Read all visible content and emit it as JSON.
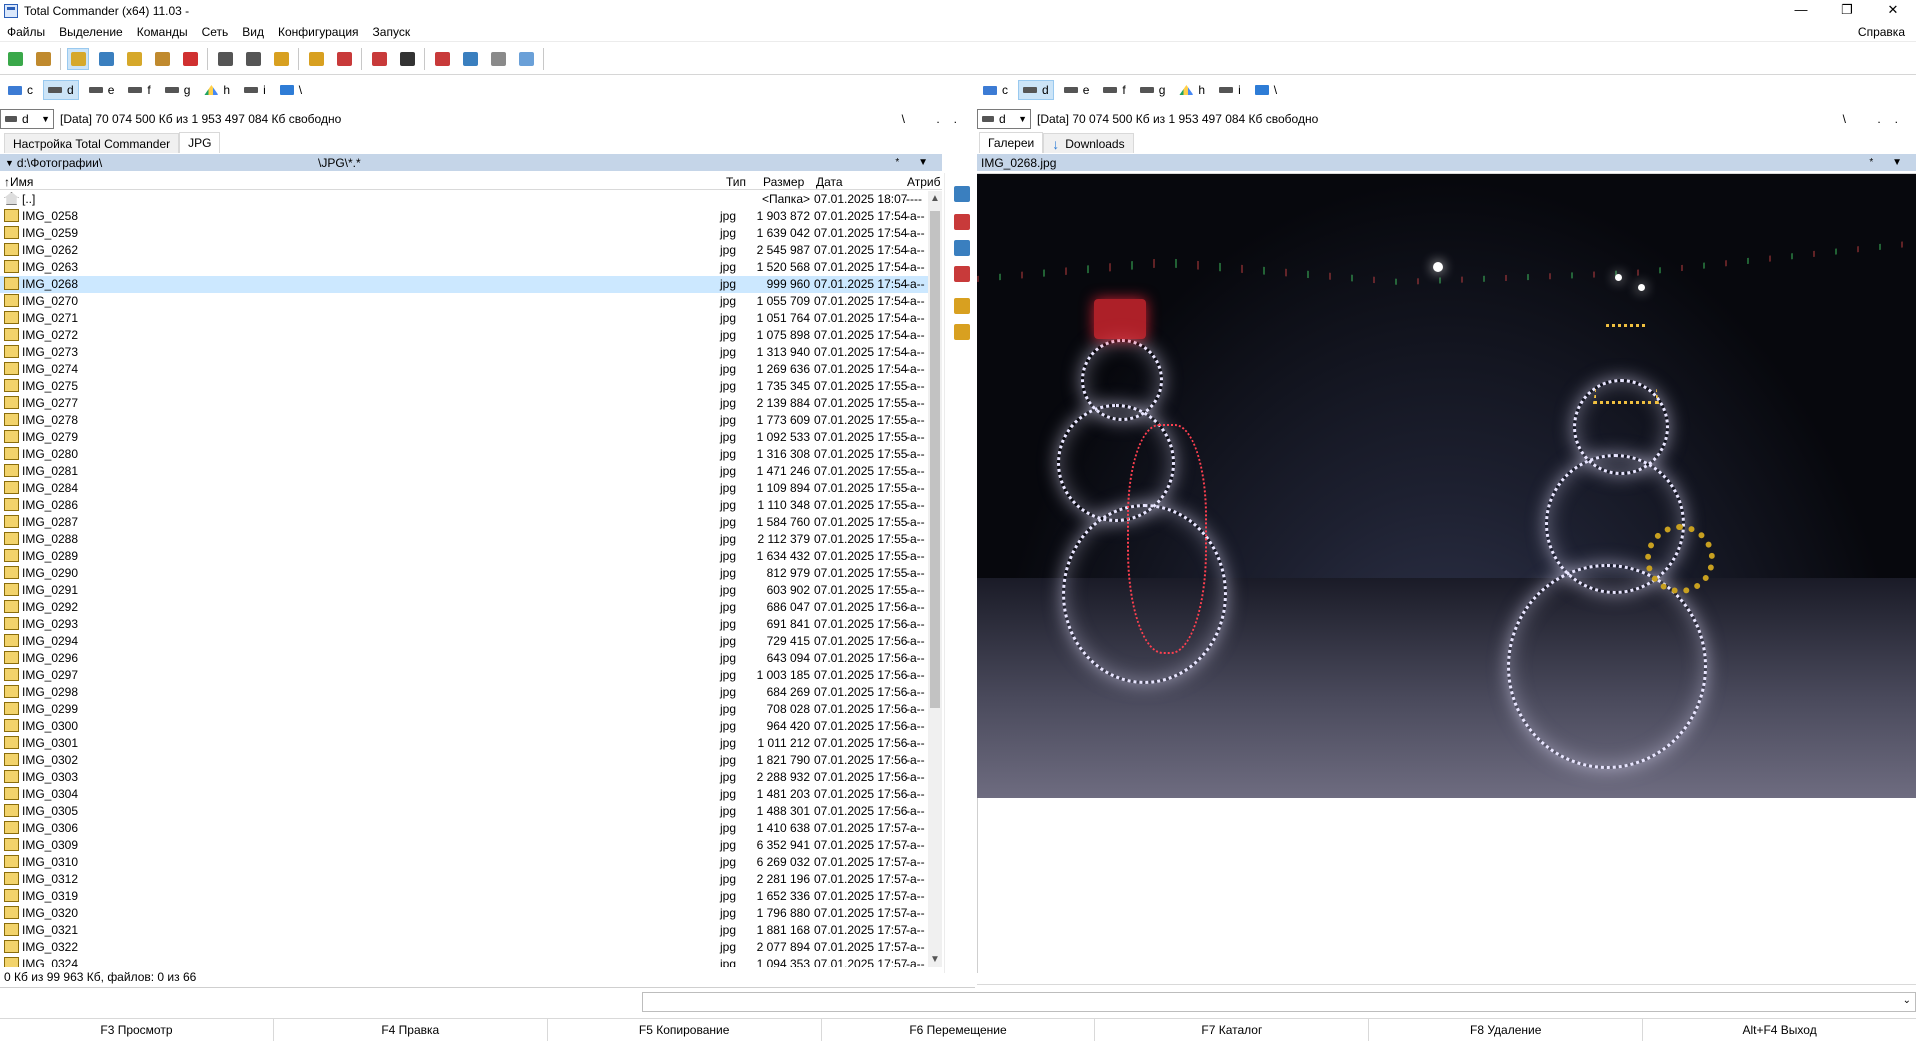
{
  "window": {
    "title": "Total Commander (x64) 11.03 -",
    "min": "—",
    "max": "❐",
    "close": "✕"
  },
  "menu": {
    "items": [
      "Файлы",
      "Выделение",
      "Команды",
      "Сеть",
      "Вид",
      "Конфигурация",
      "Запуск"
    ],
    "help": "Справка"
  },
  "toolbar": {
    "icons": [
      "refresh-icon",
      "brief-view-icon",
      "tree-view-icon",
      "thumbnails-icon",
      "invert-selection-icon",
      "sync-dirs-icon",
      "unpack-icon",
      "back-icon",
      "forward-icon",
      "pack-icon",
      "unpack-archive-icon",
      "ftp-connect-icon",
      "ftp-new-icon",
      "find-icon",
      "multi-rename-icon",
      "compare-dirs-icon",
      "copy-names-icon",
      "notepad-icon"
    ],
    "colors": [
      "#3aa84a",
      "#c08a2e",
      "#d6a82a",
      "#3a7fbf",
      "#d6a82a",
      "#c08a2e",
      "#d03030",
      "#555555",
      "#555555",
      "#d8a020",
      "#d8a020",
      "#c83a3a",
      "#c83a3a",
      "#333333",
      "#c83a3a",
      "#3a7fbf",
      "#8a8a8a",
      "#6aa0d8"
    ]
  },
  "left": {
    "drives": [
      {
        "letter": "c",
        "icon": "net",
        "active": false
      },
      {
        "letter": "d",
        "icon": "hdd",
        "active": true
      },
      {
        "letter": "e",
        "icon": "hdd",
        "active": false
      },
      {
        "letter": "f",
        "icon": "hdd",
        "active": false
      },
      {
        "letter": "g",
        "icon": "hdd",
        "active": false
      },
      {
        "letter": "h",
        "icon": "gd",
        "active": false
      },
      {
        "letter": "i",
        "icon": "hdd",
        "active": false
      },
      {
        "letter": "\\",
        "icon": "root",
        "active": false
      }
    ],
    "drive_select": "d",
    "free_info": "[Data]  70 074 500 Кб из 1 953 497 084 Кб свободно",
    "path_right": "\\ ..",
    "tabs": [
      {
        "label": "Настройка Total Commander",
        "active": false
      },
      {
        "label": "JPG",
        "active": true
      }
    ],
    "path": "d:\\Фотографии\\",
    "filter": "\\JPG\\*.*",
    "path_flags": "* ▼",
    "columns": {
      "name": "↑Имя",
      "ext": "Тип",
      "size": "Размер",
      "date": "Дата",
      "attr": "Атриб"
    },
    "files": [
      {
        "name": "[..]",
        "ext": "",
        "size": "<Папка>",
        "date": "07.01.2025 18:07",
        "attr": "----",
        "up": true
      },
      {
        "name": "IMG_0258",
        "ext": "jpg",
        "size": "1 903 872",
        "date": "07.01.2025 17:54",
        "attr": "-a--"
      },
      {
        "name": "IMG_0259",
        "ext": "jpg",
        "size": "1 639 042",
        "date": "07.01.2025 17:54",
        "attr": "-a--"
      },
      {
        "name": "IMG_0262",
        "ext": "jpg",
        "size": "2 545 987",
        "date": "07.01.2025 17:54",
        "attr": "-a--"
      },
      {
        "name": "IMG_0263",
        "ext": "jpg",
        "size": "1 520 568",
        "date": "07.01.2025 17:54",
        "attr": "-a--"
      },
      {
        "name": "IMG_0268",
        "ext": "jpg",
        "size": "999 960",
        "date": "07.01.2025 17:54",
        "attr": "-a--",
        "selected": true
      },
      {
        "name": "IMG_0270",
        "ext": "jpg",
        "size": "1 055 709",
        "date": "07.01.2025 17:54",
        "attr": "-a--"
      },
      {
        "name": "IMG_0271",
        "ext": "jpg",
        "size": "1 051 764",
        "date": "07.01.2025 17:54",
        "attr": "-a--"
      },
      {
        "name": "IMG_0272",
        "ext": "jpg",
        "size": "1 075 898",
        "date": "07.01.2025 17:54",
        "attr": "-a--"
      },
      {
        "name": "IMG_0273",
        "ext": "jpg",
        "size": "1 313 940",
        "date": "07.01.2025 17:54",
        "attr": "-a--"
      },
      {
        "name": "IMG_0274",
        "ext": "jpg",
        "size": "1 269 636",
        "date": "07.01.2025 17:54",
        "attr": "-a--"
      },
      {
        "name": "IMG_0275",
        "ext": "jpg",
        "size": "1 735 345",
        "date": "07.01.2025 17:55",
        "attr": "-a--"
      },
      {
        "name": "IMG_0277",
        "ext": "jpg",
        "size": "2 139 884",
        "date": "07.01.2025 17:55",
        "attr": "-a--"
      },
      {
        "name": "IMG_0278",
        "ext": "jpg",
        "size": "1 773 609",
        "date": "07.01.2025 17:55",
        "attr": "-a--"
      },
      {
        "name": "IMG_0279",
        "ext": "jpg",
        "size": "1 092 533",
        "date": "07.01.2025 17:55",
        "attr": "-a--"
      },
      {
        "name": "IMG_0280",
        "ext": "jpg",
        "size": "1 316 308",
        "date": "07.01.2025 17:55",
        "attr": "-a--"
      },
      {
        "name": "IMG_0281",
        "ext": "jpg",
        "size": "1 471 246",
        "date": "07.01.2025 17:55",
        "attr": "-a--"
      },
      {
        "name": "IMG_0284",
        "ext": "jpg",
        "size": "1 109 894",
        "date": "07.01.2025 17:55",
        "attr": "-a--"
      },
      {
        "name": "IMG_0286",
        "ext": "jpg",
        "size": "1 110 348",
        "date": "07.01.2025 17:55",
        "attr": "-a--"
      },
      {
        "name": "IMG_0287",
        "ext": "jpg",
        "size": "1 584 760",
        "date": "07.01.2025 17:55",
        "attr": "-a--"
      },
      {
        "name": "IMG_0288",
        "ext": "jpg",
        "size": "2 112 379",
        "date": "07.01.2025 17:55",
        "attr": "-a--"
      },
      {
        "name": "IMG_0289",
        "ext": "jpg",
        "size": "1 634 432",
        "date": "07.01.2025 17:55",
        "attr": "-a--"
      },
      {
        "name": "IMG_0290",
        "ext": "jpg",
        "size": "812 979",
        "date": "07.01.2025 17:55",
        "attr": "-a--"
      },
      {
        "name": "IMG_0291",
        "ext": "jpg",
        "size": "603 902",
        "date": "07.01.2025 17:55",
        "attr": "-a--"
      },
      {
        "name": "IMG_0292",
        "ext": "jpg",
        "size": "686 047",
        "date": "07.01.2025 17:56",
        "attr": "-a--"
      },
      {
        "name": "IMG_0293",
        "ext": "jpg",
        "size": "691 841",
        "date": "07.01.2025 17:56",
        "attr": "-a--"
      },
      {
        "name": "IMG_0294",
        "ext": "jpg",
        "size": "729 415",
        "date": "07.01.2025 17:56",
        "attr": "-a--"
      },
      {
        "name": "IMG_0296",
        "ext": "jpg",
        "size": "643 094",
        "date": "07.01.2025 17:56",
        "attr": "-a--"
      },
      {
        "name": "IMG_0297",
        "ext": "jpg",
        "size": "1 003 185",
        "date": "07.01.2025 17:56",
        "attr": "-a--"
      },
      {
        "name": "IMG_0298",
        "ext": "jpg",
        "size": "684 269",
        "date": "07.01.2025 17:56",
        "attr": "-a--"
      },
      {
        "name": "IMG_0299",
        "ext": "jpg",
        "size": "708 028",
        "date": "07.01.2025 17:56",
        "attr": "-a--"
      },
      {
        "name": "IMG_0300",
        "ext": "jpg",
        "size": "964 420",
        "date": "07.01.2025 17:56",
        "attr": "-a--"
      },
      {
        "name": "IMG_0301",
        "ext": "jpg",
        "size": "1 011 212",
        "date": "07.01.2025 17:56",
        "attr": "-a--"
      },
      {
        "name": "IMG_0302",
        "ext": "jpg",
        "size": "1 821 790",
        "date": "07.01.2025 17:56",
        "attr": "-a--"
      },
      {
        "name": "IMG_0303",
        "ext": "jpg",
        "size": "2 288 932",
        "date": "07.01.2025 17:56",
        "attr": "-a--"
      },
      {
        "name": "IMG_0304",
        "ext": "jpg",
        "size": "1 481 203",
        "date": "07.01.2025 17:56",
        "attr": "-a--"
      },
      {
        "name": "IMG_0305",
        "ext": "jpg",
        "size": "1 488 301",
        "date": "07.01.2025 17:56",
        "attr": "-a--"
      },
      {
        "name": "IMG_0306",
        "ext": "jpg",
        "size": "1 410 638",
        "date": "07.01.2025 17:57",
        "attr": "-a--"
      },
      {
        "name": "IMG_0309",
        "ext": "jpg",
        "size": "6 352 941",
        "date": "07.01.2025 17:57",
        "attr": "-a--"
      },
      {
        "name": "IMG_0310",
        "ext": "jpg",
        "size": "6 269 032",
        "date": "07.01.2025 17:57",
        "attr": "-a--"
      },
      {
        "name": "IMG_0312",
        "ext": "jpg",
        "size": "2 281 196",
        "date": "07.01.2025 17:57",
        "attr": "-a--"
      },
      {
        "name": "IMG_0319",
        "ext": "jpg",
        "size": "1 652 336",
        "date": "07.01.2025 17:57",
        "attr": "-a--"
      },
      {
        "name": "IMG_0320",
        "ext": "jpg",
        "size": "1 796 880",
        "date": "07.01.2025 17:57",
        "attr": "-a--"
      },
      {
        "name": "IMG_0321",
        "ext": "jpg",
        "size": "1 881 168",
        "date": "07.01.2025 17:57",
        "attr": "-a--"
      },
      {
        "name": "IMG_0322",
        "ext": "jpg",
        "size": "2 077 894",
        "date": "07.01.2025 17:57",
        "attr": "-a--"
      },
      {
        "name": "IMG_0324",
        "ext": "jpg",
        "size": "1 094 353",
        "date": "07.01.2025 17:57",
        "attr": "-a--"
      }
    ],
    "scroll_position": 0.0,
    "status": "0 Кб из 99 963 Кб, файлов: 0 из 66"
  },
  "midbar": {
    "icons": [
      "view-icon",
      "edit-icon",
      "copy-icon",
      "move-icon",
      "pack-icon",
      "new-folder-icon"
    ],
    "colors": [
      "#3a7fbf",
      "#c83a3a",
      "#3a7fbf",
      "#c83a3a",
      "#d8a020",
      "#d8a020"
    ]
  },
  "right": {
    "drives": [
      {
        "letter": "c",
        "icon": "net",
        "active": false
      },
      {
        "letter": "d",
        "icon": "hdd",
        "active": true
      },
      {
        "letter": "e",
        "icon": "hdd",
        "active": false
      },
      {
        "letter": "f",
        "icon": "hdd",
        "active": false
      },
      {
        "letter": "g",
        "icon": "hdd",
        "active": false
      },
      {
        "letter": "h",
        "icon": "gd",
        "active": false
      },
      {
        "letter": "i",
        "icon": "hdd",
        "active": false
      },
      {
        "letter": "\\",
        "icon": "root",
        "active": false
      }
    ],
    "drive_select": "d",
    "free_info": "[Data]  70 074 500 Кб из 1 953 497 084 Кб свободно",
    "path_right": "\\ ..",
    "tabs": [
      {
        "label": "Галереи",
        "active": true,
        "icon": false
      },
      {
        "label": "Downloads",
        "active": false,
        "icon": true
      }
    ],
    "path": "IMG_0268.jpg",
    "path_flags": "* ▼"
  },
  "command_line": {
    "value": "",
    "arrow": "⌄"
  },
  "fkeys": [
    "F3 Просмотр",
    "F4 Правка",
    "F5 Копирование",
    "F6 Перемещение",
    "F7 Каталог",
    "F8 Удаление",
    "Alt+F4 Выход"
  ]
}
